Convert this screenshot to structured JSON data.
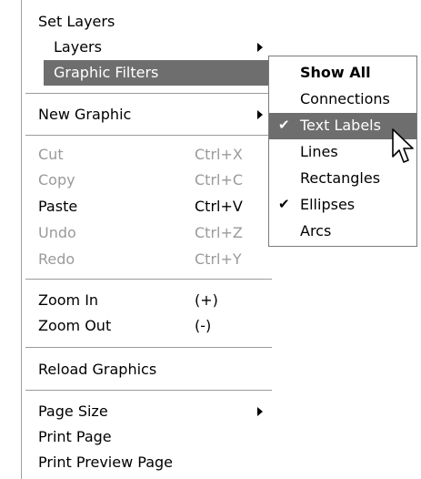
{
  "menu": {
    "set_layers": "Set Layers",
    "layers": "Layers",
    "graphic_filters": "Graphic Filters",
    "new_graphic": "New Graphic",
    "cut": "Cut",
    "cut_shortcut": "Ctrl+X",
    "copy": "Copy",
    "copy_shortcut": "Ctrl+C",
    "paste": "Paste",
    "paste_shortcut": "Ctrl+V",
    "undo": "Undo",
    "undo_shortcut": "Ctrl+Z",
    "redo": "Redo",
    "redo_shortcut": "Ctrl+Y",
    "zoom_in": "Zoom In",
    "zoom_in_shortcut": "(+)",
    "zoom_out": "Zoom Out",
    "zoom_out_shortcut": "(-)",
    "reload_graphics": "Reload Graphics",
    "page_size": "Page Size",
    "print_page": "Print Page",
    "print_preview_page": "Print Preview Page"
  },
  "submenu": {
    "show_all": "Show All",
    "connections": "Connections",
    "text_labels": "Text Labels",
    "lines": "Lines",
    "rectangles": "Rectangles",
    "ellipses": "Ellipses",
    "arcs": "Arcs",
    "check_glyph": "✔"
  },
  "colors": {
    "highlight": "#6e6e6e",
    "disabled": "#9a9a9a"
  }
}
